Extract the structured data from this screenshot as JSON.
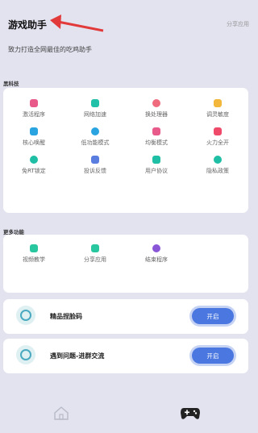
{
  "header": {
    "title": "游戏助手",
    "share_label": "分享应用",
    "subtitle": "致力打造全网最佳的吃鸡助手"
  },
  "sections": {
    "tech_label": "黑科技",
    "more_label": "更多功能"
  },
  "tech_items": [
    {
      "label": "激活程序",
      "icon": "activate-icon",
      "color": "#e75a8a"
    },
    {
      "label": "网络加速",
      "icon": "network-icon",
      "color": "#21c0a8"
    },
    {
      "label": "换处理器",
      "icon": "cpu-icon",
      "color": "#ef6a7c"
    },
    {
      "label": "调灵敏度",
      "icon": "sensitivity-icon",
      "color": "#f3b73b"
    },
    {
      "label": "核心唤醒",
      "icon": "core-icon",
      "color": "#2aa4e0"
    },
    {
      "label": "低功能模式",
      "icon": "lowpower-icon",
      "color": "#2aa4e0"
    },
    {
      "label": "均衡模式",
      "icon": "balance-icon",
      "color": "#e75a8a"
    },
    {
      "label": "火力全开",
      "icon": "fire-icon",
      "color": "#ef4a6a"
    },
    {
      "label": "免RT锁定",
      "icon": "rt-lock-icon",
      "color": "#1fbfa5"
    },
    {
      "label": "投诉反馈",
      "icon": "feedback-icon",
      "color": "#5a7de0"
    },
    {
      "label": "用户协议",
      "icon": "agreement-icon",
      "color": "#1fbfa5"
    },
    {
      "label": "隐私政策",
      "icon": "privacy-icon",
      "color": "#1fbfa5"
    }
  ],
  "more_items": [
    {
      "label": "视频教学",
      "icon": "video-icon",
      "color": "#28c7a0"
    },
    {
      "label": "分享应用",
      "icon": "share-icon",
      "color": "#28c7a0"
    },
    {
      "label": "结束程序",
      "icon": "exit-icon",
      "color": "#8a56d8"
    }
  ],
  "rows": [
    {
      "title": "精品捏脸码",
      "button": "开启"
    },
    {
      "title": "遇到问题-进群交流",
      "button": "开启"
    }
  ]
}
